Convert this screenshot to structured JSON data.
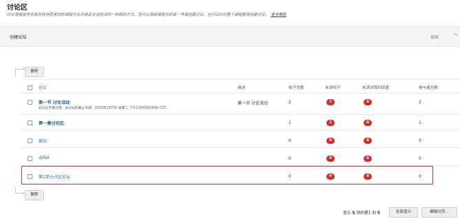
{
  "page": {
    "title": "讨论区",
    "description": "讨论是鼓励学生批判性地思考您的课程作业并彼此交流想法的一种很好方式。您可以围绕课程中的某一节课创建讨论，也可以针对整个课程整体创建讨论。",
    "more_help": "更多帮助"
  },
  "toolbar": {
    "create_label": "创建论坛",
    "search_label": "搜索"
  },
  "actions": {
    "delete_top": "删除",
    "delete_bottom": "删除"
  },
  "table": {
    "headers": {
      "forum": "论坛",
      "description": "描述",
      "total_posts": "帖子总数",
      "unread_posts": "未读帖子",
      "unread_replies": "未读对我的回复",
      "participants": "参与者总数"
    },
    "rows": [
      {
        "name": "第一节 讨论活动",
        "note": "此论坛不再可用。此论坛的截止日期：2020年1月7日 星期二 下午11时59分00秒 CST。",
        "description": "第一节 讨论活动",
        "total_posts": "2",
        "unread_posts": "2",
        "unread_replies": "0",
        "participants": "2"
      },
      {
        "name": "第一章讨论区",
        "note": "",
        "description": "",
        "total_posts": "1",
        "unread_posts": "1",
        "unread_replies": "0",
        "participants": "1"
      },
      {
        "name": "跳乐",
        "note": "",
        "description": "",
        "total_posts": "0",
        "unread_posts": "0",
        "unread_replies": "0",
        "participants": "0"
      },
      {
        "name": "djflek",
        "note": "",
        "description": "",
        "total_posts": "0",
        "unread_posts": "0",
        "unread_replies": "0",
        "participants": "0"
      },
      {
        "name": "第1单元讨论论坛",
        "note": "",
        "description": "",
        "total_posts": "0",
        "unread_posts": "0",
        "unread_replies": "0",
        "participants": "0"
      }
    ]
  },
  "pagination": {
    "prefix": "显示",
    "start": "5",
    "mid": "项的第1 到",
    "end": "5",
    "show_all": "全部显示",
    "edit_paging": "编辑分页..."
  },
  "colors": {
    "badge": "#d42b2b",
    "highlight_border": "#c8383c",
    "link": "#2c6fa8"
  }
}
